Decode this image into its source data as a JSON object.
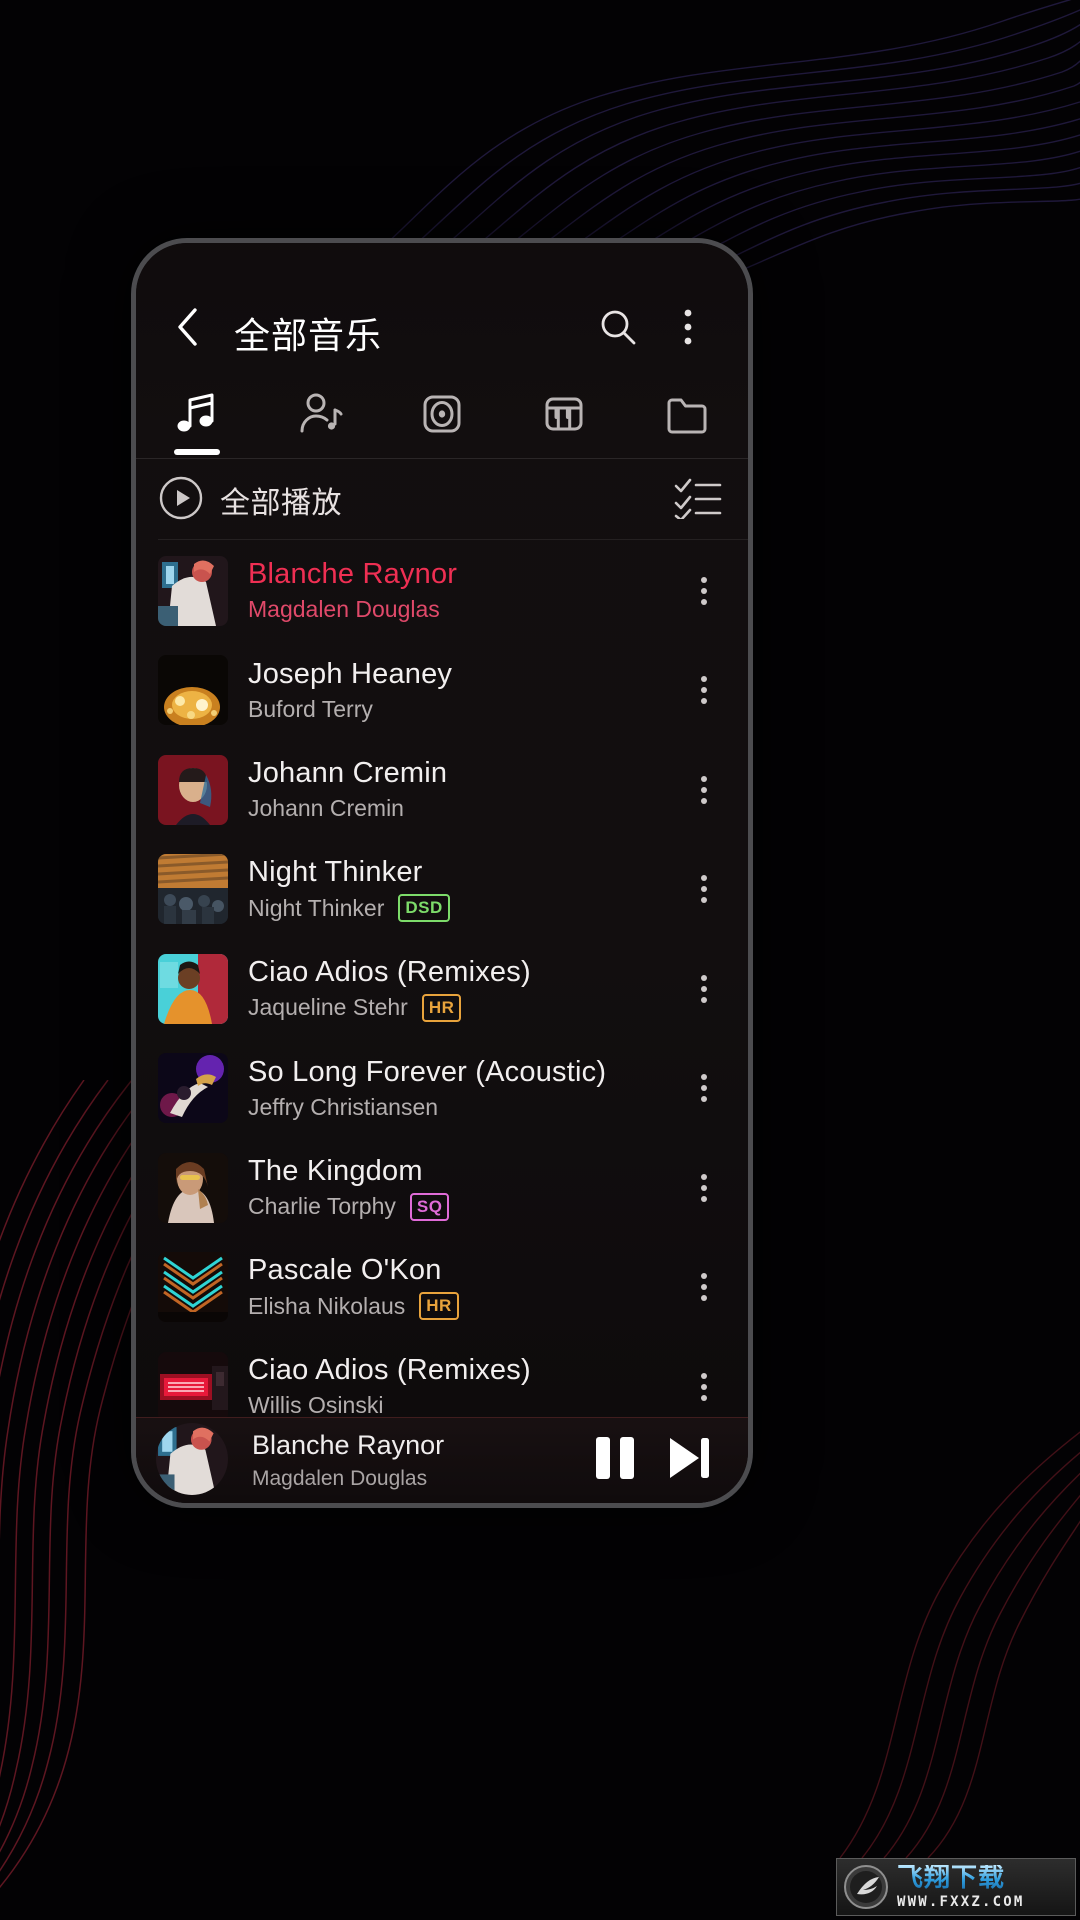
{
  "appbar": {
    "back_icon": "chevron-left-icon",
    "title": "全部音乐",
    "search_icon": "search-icon",
    "overflow_icon": "more-vertical-icon"
  },
  "tabs": [
    {
      "id": "songs",
      "icon": "music-note-icon",
      "active": true
    },
    {
      "id": "artists",
      "icon": "artist-icon",
      "active": false
    },
    {
      "id": "albums",
      "icon": "album-icon",
      "active": false
    },
    {
      "id": "genres",
      "icon": "piano-icon",
      "active": false
    },
    {
      "id": "folders",
      "icon": "folder-icon",
      "active": false
    }
  ],
  "playall": {
    "icon": "play-circle-icon",
    "label": "全部播放",
    "multiselect_icon": "checklist-icon"
  },
  "songs": [
    {
      "title": "Blanche Raynor",
      "artist": "Magdalen Douglas",
      "badge": "",
      "playing": true,
      "art": "a1"
    },
    {
      "title": "Joseph Heaney",
      "artist": "Buford Terry",
      "badge": "",
      "playing": false,
      "art": "a2"
    },
    {
      "title": "Johann Cremin",
      "artist": "Johann Cremin",
      "badge": "",
      "playing": false,
      "art": "a3"
    },
    {
      "title": "Night Thinker",
      "artist": "Night Thinker",
      "badge": "DSD",
      "playing": false,
      "art": "a4"
    },
    {
      "title": "Ciao Adios (Remixes)",
      "artist": "Jaqueline Stehr",
      "badge": "HR",
      "playing": false,
      "art": "a5"
    },
    {
      "title": "So Long Forever (Acoustic)",
      "artist": "Jeffry Christiansen",
      "badge": "",
      "playing": false,
      "art": "a6"
    },
    {
      "title": "The Kingdom",
      "artist": "Charlie Torphy",
      "badge": "SQ",
      "playing": false,
      "art": "a7"
    },
    {
      "title": "Pascale O'Kon",
      "artist": "Elisha Nikolaus",
      "badge": "HR",
      "playing": false,
      "art": "a8"
    },
    {
      "title": "Ciao Adios (Remixes)",
      "artist": "Willis Osinski",
      "badge": "",
      "playing": false,
      "art": "a9"
    }
  ],
  "miniplayer": {
    "title": "Blanche Raynor",
    "artist": "Magdalen Douglas",
    "pause_icon": "pause-icon",
    "next_icon": "next-track-icon"
  },
  "watermark": {
    "name": "飞翔下载",
    "url": "WWW.FXXZ.COM"
  },
  "colors": {
    "accent_playing": "#ef2f53",
    "badge_dsd": "#7ddc6a",
    "badge_hr": "#e8a33c",
    "badge_sq": "#e06bd8"
  }
}
